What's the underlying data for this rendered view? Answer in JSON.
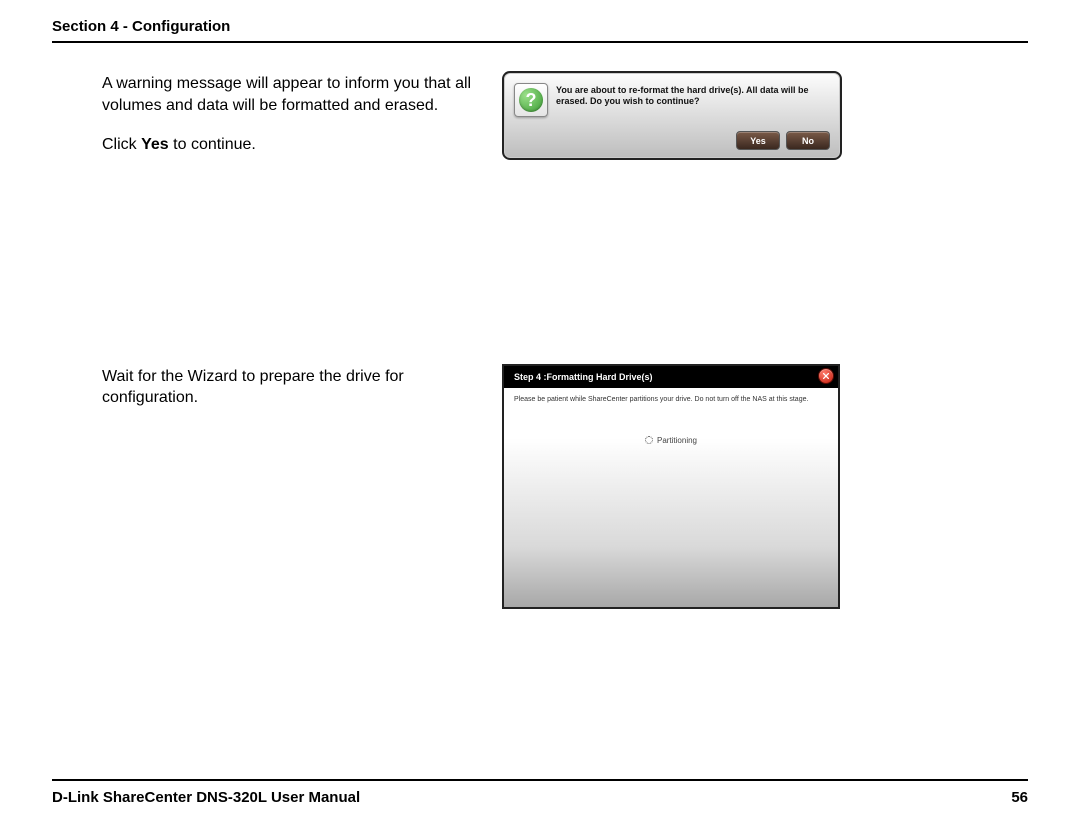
{
  "header": {
    "title": "Section 4 - Configuration"
  },
  "block1": {
    "para1": "A warning message will appear to inform you that all volumes and data will be formatted and erased.",
    "para2_pre": "Click ",
    "para2_bold": "Yes",
    "para2_post": " to continue.",
    "dialog": {
      "message": "You are about to re-format the hard drive(s). All data will be erased. Do you wish to continue?",
      "yes": "Yes",
      "no": "No"
    }
  },
  "block2": {
    "para": "Wait for the Wizard to prepare the drive for configuration.",
    "dialog": {
      "title": "Step 4 :Formatting Hard Drive(s)",
      "msg": "Please be patient while ShareCenter partitions your drive. Do not turn off the NAS at this stage.",
      "status": "Partitioning"
    }
  },
  "footer": {
    "manual": "D-Link ShareCenter DNS-320L User Manual",
    "page": "56"
  }
}
